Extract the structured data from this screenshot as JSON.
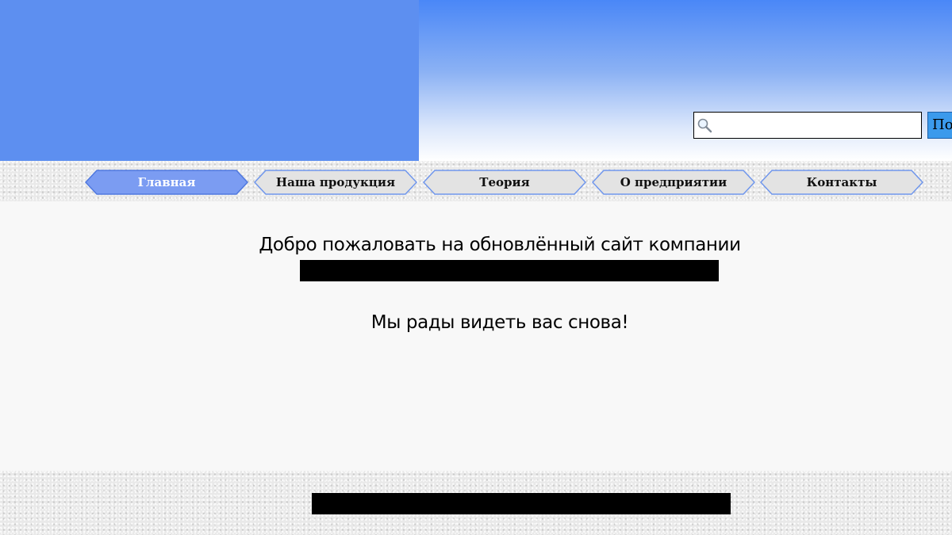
{
  "search": {
    "placeholder": "",
    "value": "",
    "button_label": "Поиск"
  },
  "nav": {
    "items": [
      {
        "label": "Главная",
        "active": true
      },
      {
        "label": "Наша продукция",
        "active": false
      },
      {
        "label": "Теория",
        "active": false
      },
      {
        "label": "О предприятии",
        "active": false
      },
      {
        "label": "Контакты",
        "active": false
      }
    ]
  },
  "main": {
    "welcome_text": "Добро пожаловать на обновлённый сайт компании",
    "tagline": "Мы рады видеть вас снова!"
  },
  "colors": {
    "header_blue": "#5d8ff0",
    "active_tab": "#7b9cf2",
    "inactive_tab": "#e3e3e3",
    "tab_border": "#6f96ec",
    "search_button": "#3b9aec"
  },
  "icons": {
    "search": "magnifier-icon"
  }
}
